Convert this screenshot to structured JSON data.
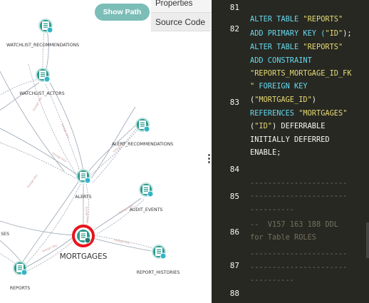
{
  "toolbar": {
    "show_path_label": "Show Path"
  },
  "side_tabs": [
    {
      "label": "Properties",
      "active": false
    },
    {
      "label": "Source Code",
      "active": true
    }
  ],
  "graph": {
    "nodes": [
      {
        "id": "watchlist_recommendations",
        "label": "WATCHLIST_RECOMMENDATIONS"
      },
      {
        "id": "watchlist_actors",
        "label": "WATCHLIST_ACTORS"
      },
      {
        "id": "alert_recommendations",
        "label": "ALERT_RECOMMENDATIONS"
      },
      {
        "id": "alerts",
        "label": "ALERTS"
      },
      {
        "id": "audit_events",
        "label": "AUDIT_EVENTS"
      },
      {
        "id": "mortgages",
        "label": "MORTGAGES",
        "selected": true
      },
      {
        "id": "report_histories",
        "label": "REPORT_HISTORIES"
      },
      {
        "id": "reports",
        "label": "REPORTS"
      },
      {
        "id": "offscreen_ses",
        "label": "SES"
      }
    ]
  },
  "colors": {
    "node": "#2b9a8c",
    "selected_ring": "#e8141c",
    "accent_button": "#7bbdb7",
    "code_bg": "#272822"
  },
  "code": {
    "line_numbers": [
      "81",
      "82",
      "83",
      "84",
      "85",
      "86",
      "87",
      "88"
    ],
    "lines": [
      [
        {
          "t": "ALTER TABLE ",
          "c": "kw"
        },
        {
          "t": "\"REPORTS\"",
          "c": "str"
        }
      ],
      [
        {
          "t": "ADD PRIMARY KEY (",
          "c": "kw"
        },
        {
          "t": "\"ID\"",
          "c": "str"
        },
        {
          "t": ");",
          "c": "pl"
        }
      ],
      [
        {
          "t": "ALTER TABLE ",
          "c": "kw"
        },
        {
          "t": "\"REPORTS\"",
          "c": "str"
        }
      ],
      [
        {
          "t": "ADD CONSTRAINT",
          "c": "kw"
        }
      ],
      [
        {
          "t": "\"REPORTS_MORTGAGE_ID_FK",
          "c": "str"
        }
      ],
      [
        {
          "t": "\"",
          "c": "str"
        },
        {
          "t": " FOREIGN KEY",
          "c": "kw"
        }
      ],
      [
        {
          "t": "(",
          "c": "pl"
        },
        {
          "t": "\"MORTGAGE_ID\"",
          "c": "str"
        },
        {
          "t": ")",
          "c": "pl"
        }
      ],
      [
        {
          "t": "REFERENCES ",
          "c": "kw"
        },
        {
          "t": "\"MORTGAGES\"",
          "c": "str"
        }
      ],
      [
        {
          "t": "(",
          "c": "pl"
        },
        {
          "t": "\"ID\"",
          "c": "str"
        },
        {
          "t": ") DEFERRABLE",
          "c": "pl"
        }
      ],
      [
        {
          "t": "INITIALLY DEFERRED",
          "c": "pl"
        }
      ],
      [
        {
          "t": "ENABLE;",
          "c": "pl"
        }
      ],
      [
        {
          "t": "----------------------",
          "c": "cm"
        }
      ],
      [
        {
          "t": "----------------------",
          "c": "cm"
        }
      ],
      [
        {
          "t": "----------",
          "c": "cm"
        }
      ],
      [
        {
          "t": "--  V157 163 188 DDL",
          "c": "cm"
        }
      ],
      [
        {
          "t": "for Table ROLES",
          "c": "cm"
        }
      ],
      [
        {
          "t": "----------------------",
          "c": "cm"
        }
      ],
      [
        {
          "t": "----------------------",
          "c": "cm"
        }
      ],
      [
        {
          "t": "----------",
          "c": "cm"
        }
      ]
    ]
  }
}
